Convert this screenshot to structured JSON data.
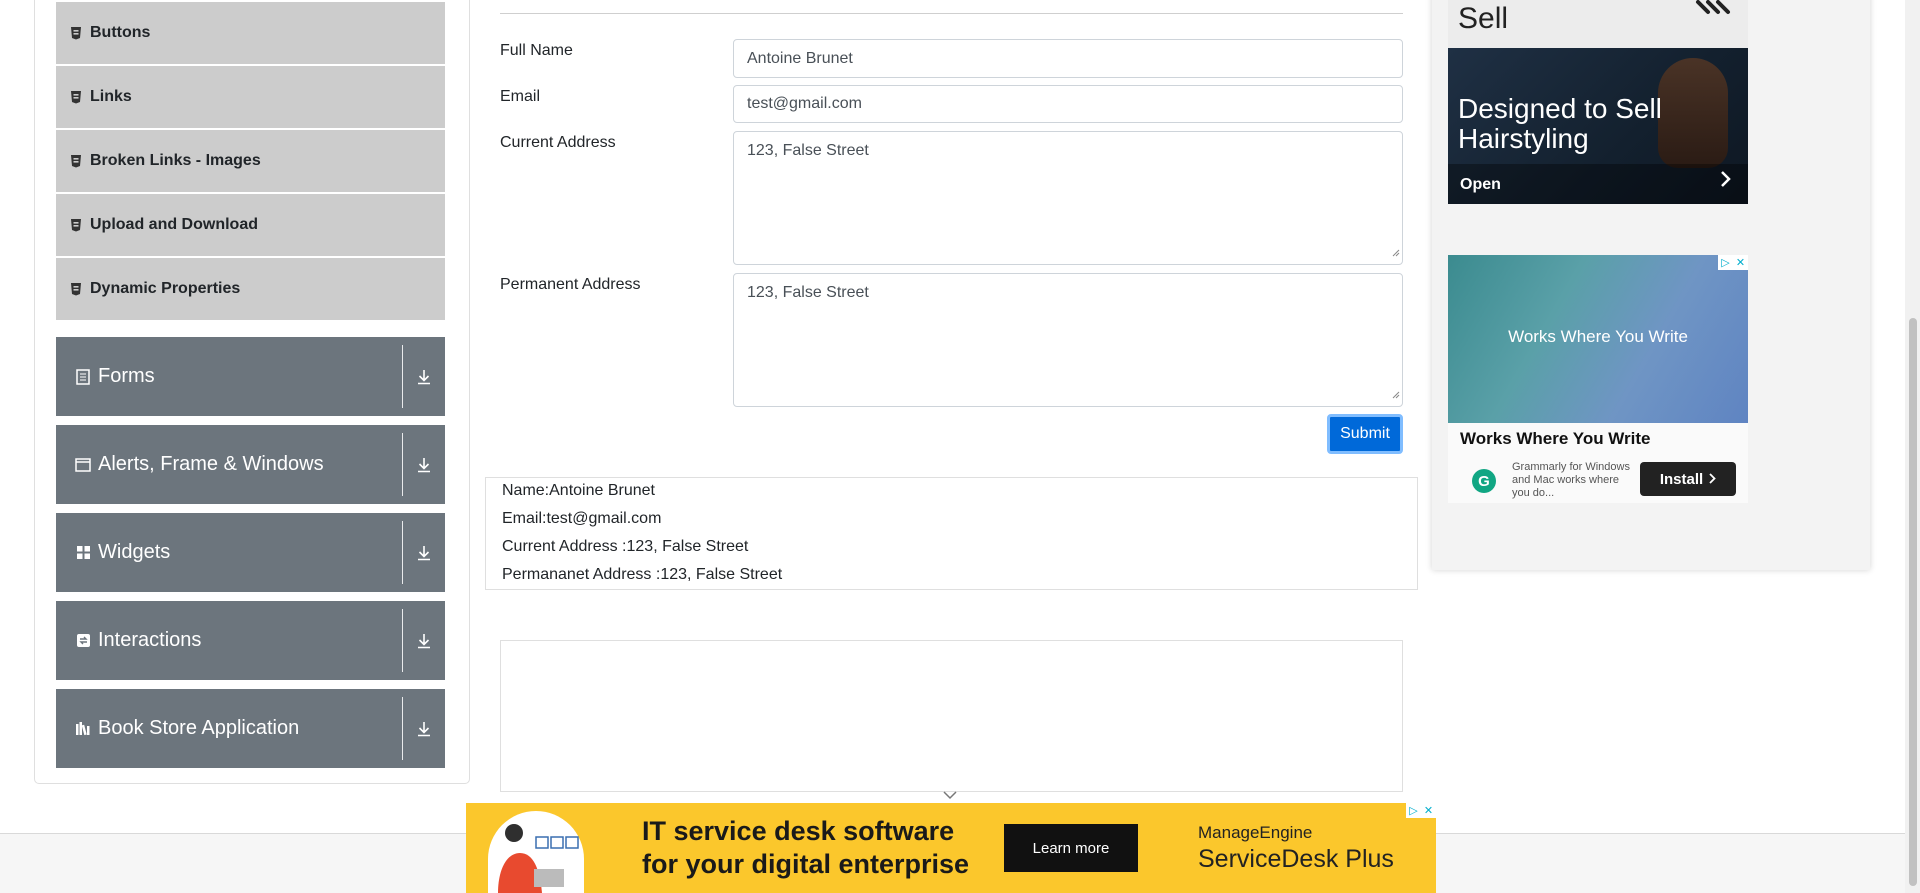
{
  "sidebar": {
    "elements_items": [
      {
        "label": "Buttons"
      },
      {
        "label": "Links"
      },
      {
        "label": "Broken Links - Images"
      },
      {
        "label": "Upload and Download"
      },
      {
        "label": "Dynamic Properties"
      }
    ],
    "groups": [
      {
        "label": "Forms",
        "icon": "form-icon"
      },
      {
        "label": "Alerts, Frame & Windows",
        "icon": "window-icon"
      },
      {
        "label": "Widgets",
        "icon": "widgets-icon"
      },
      {
        "label": "Interactions",
        "icon": "interactions-icon"
      },
      {
        "label": "Book Store Application",
        "icon": "book-icon"
      }
    ]
  },
  "form": {
    "full_name_label": "Full Name",
    "full_name_value": "Antoine Brunet",
    "email_label": "Email",
    "email_value": "test@gmail.com",
    "current_address_label": "Current Address",
    "current_address_value": "123, False Street",
    "permanent_address_label": "Permanent Address",
    "permanent_address_value": "123, False Street",
    "submit_label": "Submit"
  },
  "output": {
    "name": "Name:Antoine Brunet",
    "email": "Email:test@gmail.com",
    "current_address": "Current Address :123, False Street",
    "permanent_address": "Permananet Address :123, False Street"
  },
  "ads": {
    "ad1": {
      "top_word": "Sell",
      "headline_line1": "Designed to Sell",
      "headline_line2": "Hairstyling",
      "cta": "Open"
    },
    "ad2": {
      "visual_text": "Works Where You Write",
      "title": "Works Where You Write",
      "description": "Grammarly for Windows and Mac works where you do...",
      "cta": "Install"
    },
    "bottom": {
      "headline_line1": "IT service desk software",
      "headline_line2": "for your digital enterprise",
      "cta": "Learn more",
      "brand_line1": "ManageEngine",
      "brand_line2": "ServiceDesk Plus"
    }
  },
  "colors": {
    "sidebar_group_bg": "#6c757d",
    "sidebar_item_bg": "#cccccc",
    "submit_bg": "#0069d9",
    "bottom_ad_bg": "#fbc72c"
  }
}
